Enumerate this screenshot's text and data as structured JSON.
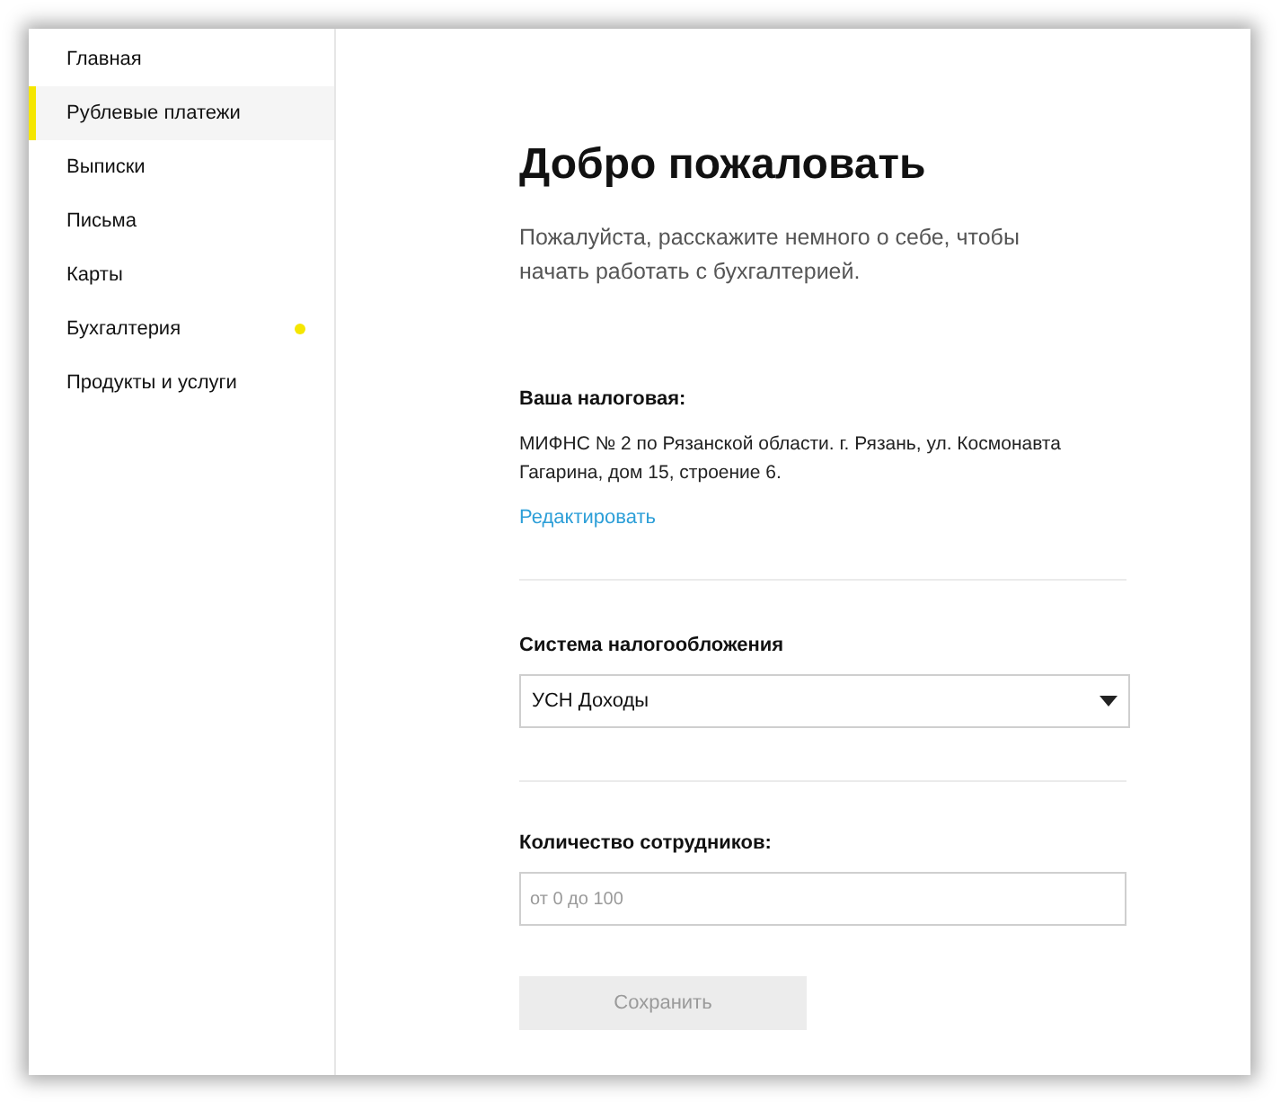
{
  "sidebar": {
    "items": [
      {
        "label": "Главная",
        "selected": false,
        "notification": false
      },
      {
        "label": "Рублевые платежи",
        "selected": true,
        "notification": false
      },
      {
        "label": "Выписки",
        "selected": false,
        "notification": false
      },
      {
        "label": "Письма",
        "selected": false,
        "notification": false
      },
      {
        "label": "Карты",
        "selected": false,
        "notification": false
      },
      {
        "label": "Бухгалтерия",
        "selected": false,
        "notification": true
      },
      {
        "label": "Продукты и услуги",
        "selected": false,
        "notification": false
      }
    ]
  },
  "main": {
    "title": "Добро пожаловать",
    "intro": "Пожалуйста, расскажите немного о себе, чтобы начать работать с бухгалтерией.",
    "tax_office": {
      "label": "Ваша налоговая:",
      "address": "МИФНС № 2 по Рязанской области. г. Рязань, ул. Космонавта Гагарина, дом 15, строение 6.",
      "edit_link": "Редактировать"
    },
    "tax_system": {
      "label": "Система налогообложения",
      "value": "УСН Доходы"
    },
    "employees": {
      "label": "Количество сотрудников:",
      "placeholder": "от 0 до 100"
    },
    "save_button": {
      "label": "Сохранить",
      "disabled": true
    }
  }
}
